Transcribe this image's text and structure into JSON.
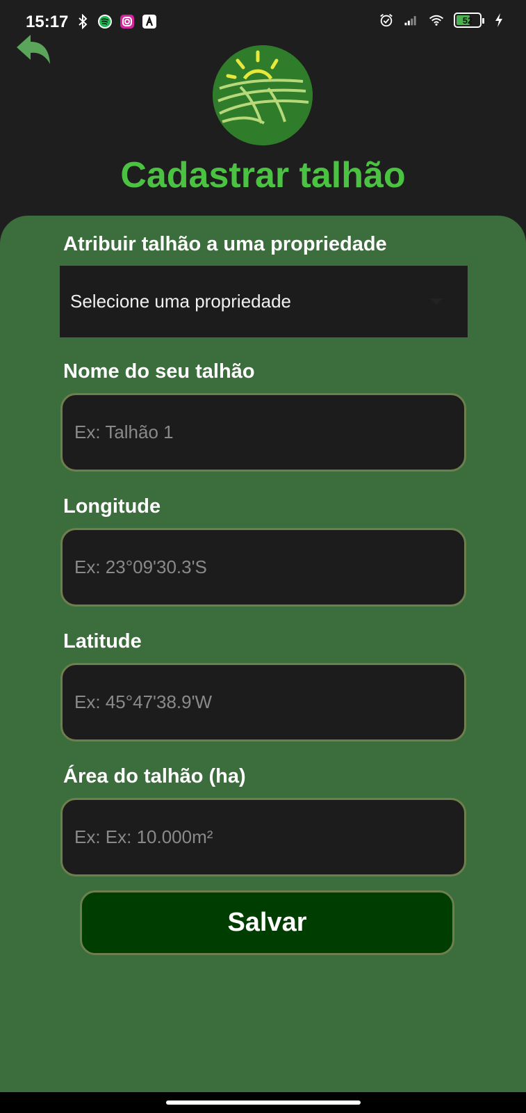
{
  "status_bar": {
    "time": "15:17",
    "battery_level": "52",
    "left_icons": [
      "bluetooth-icon",
      "spotify-icon",
      "instagram-icon",
      "app-icon"
    ],
    "right_icons": [
      "alarm-icon",
      "signal-icon",
      "wifi-icon",
      "battery-icon",
      "charging-icon"
    ]
  },
  "header": {
    "title": "Cadastrar talhão",
    "back_icon": "back-arrow-icon"
  },
  "form": {
    "property": {
      "label": "Atribuir talhão a uma propriedade",
      "selected": "Selecione uma propriedade"
    },
    "name": {
      "label": "Nome do seu talhão",
      "placeholder": "Ex: Talhão 1"
    },
    "longitude": {
      "label": "Longitude",
      "placeholder": "Ex: 23°09'30.3'S"
    },
    "latitude": {
      "label": "Latitude",
      "placeholder": "Ex: 45°47'38.9'W"
    },
    "area": {
      "label": "Área do talhão (ha)",
      "placeholder": "Ex: Ex: 10.000m²"
    },
    "save_label": "Salvar"
  },
  "colors": {
    "background": "#1e1e1e",
    "card": "#3c6d3c",
    "title": "#4cc243",
    "input_bg": "#1c1c1c",
    "input_border": "#6c7f4c",
    "button_bg": "#003d00"
  }
}
